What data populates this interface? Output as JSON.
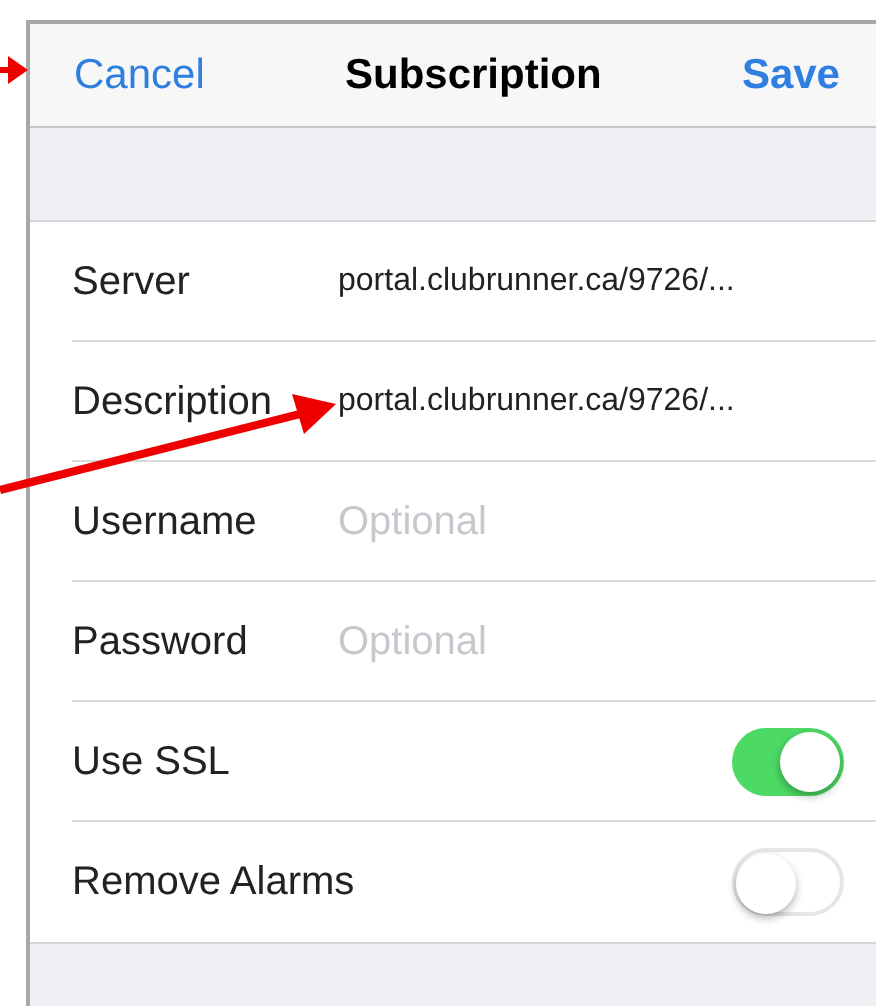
{
  "nav_bar": {
    "cancel": "Cancel",
    "title": "Subscription",
    "save": "Save"
  },
  "rows": [
    {
      "kind": "field",
      "label": "Server",
      "value": "portal.clubrunner.ca/9726/..."
    },
    {
      "kind": "field",
      "label": "Description",
      "value": "portal.clubrunner.ca/9726/..."
    },
    {
      "kind": "field",
      "label": "Username",
      "placeholder": "Optional"
    },
    {
      "kind": "field",
      "label": "Password",
      "placeholder": "Optional"
    },
    {
      "kind": "toggle",
      "label": "Use SSL",
      "on": true
    },
    {
      "kind": "toggle",
      "label": "Remove Alarms",
      "on": false
    }
  ]
}
